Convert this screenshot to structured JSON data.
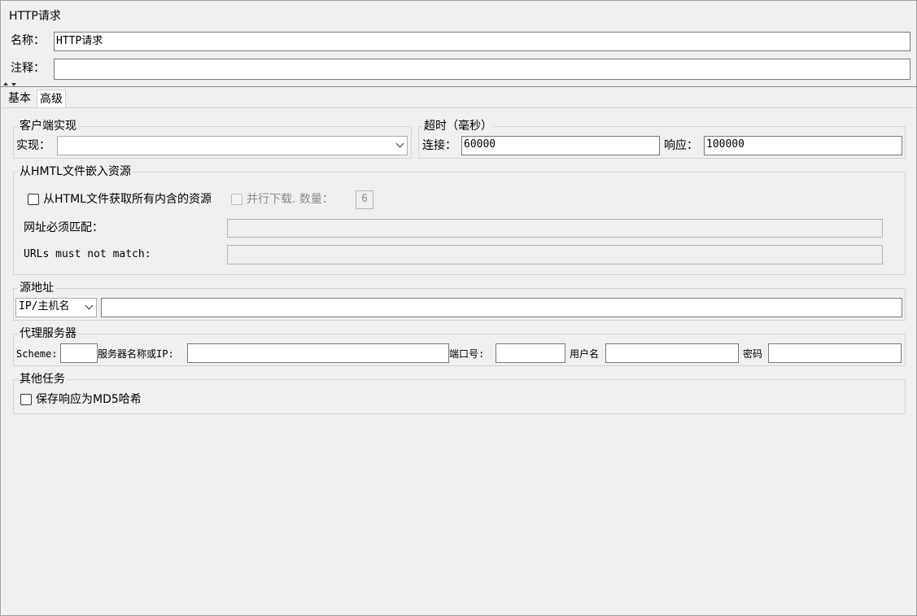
{
  "panel": {
    "title": "HTTP请求"
  },
  "name_field": {
    "label": "名称：",
    "value": "HTTP请求"
  },
  "comment_field": {
    "label": "注释：",
    "value": ""
  },
  "tabs": [
    {
      "label": "基本"
    },
    {
      "label": "高级"
    }
  ],
  "client_impl": {
    "title": "客户端实现",
    "label": "实现：",
    "value": ""
  },
  "timeout": {
    "title": "超时（毫秒）",
    "connect_label": "连接：",
    "connect_value": "60000",
    "response_label": "响应：",
    "response_value": "100000"
  },
  "embedded": {
    "title": "从HMTL文件嵌入资源",
    "retrieve_label": "从HTML文件获取所有内含的资源",
    "retrieve_checked": false,
    "parallel_label": "并行下载. 数量：",
    "parallel_checked": false,
    "parallel_count": "6",
    "must_match_label": "网址必须匹配：",
    "must_match_value": "",
    "must_not_match_label": "URLs must not match:",
    "must_not_match_value": ""
  },
  "source_address": {
    "title": "源地址",
    "type_selected": "IP/主机名",
    "value": ""
  },
  "proxy": {
    "title": "代理服务器",
    "scheme_label": "Scheme:",
    "scheme_value": "",
    "server_label": "服务器名称或IP:",
    "server_value": "",
    "port_label": "端口号:",
    "port_value": "",
    "user_label": "用户名",
    "user_value": "",
    "password_label": "密码",
    "password_value": ""
  },
  "other_tasks": {
    "title": "其他任务",
    "md5_label": "保存响应为MD5哈希",
    "md5_checked": false
  },
  "colors": {
    "background": "#f0f0f0",
    "input_bg": "#ffffff",
    "border": "#7a7a7a",
    "disabled_text": "#8a8a8a"
  }
}
